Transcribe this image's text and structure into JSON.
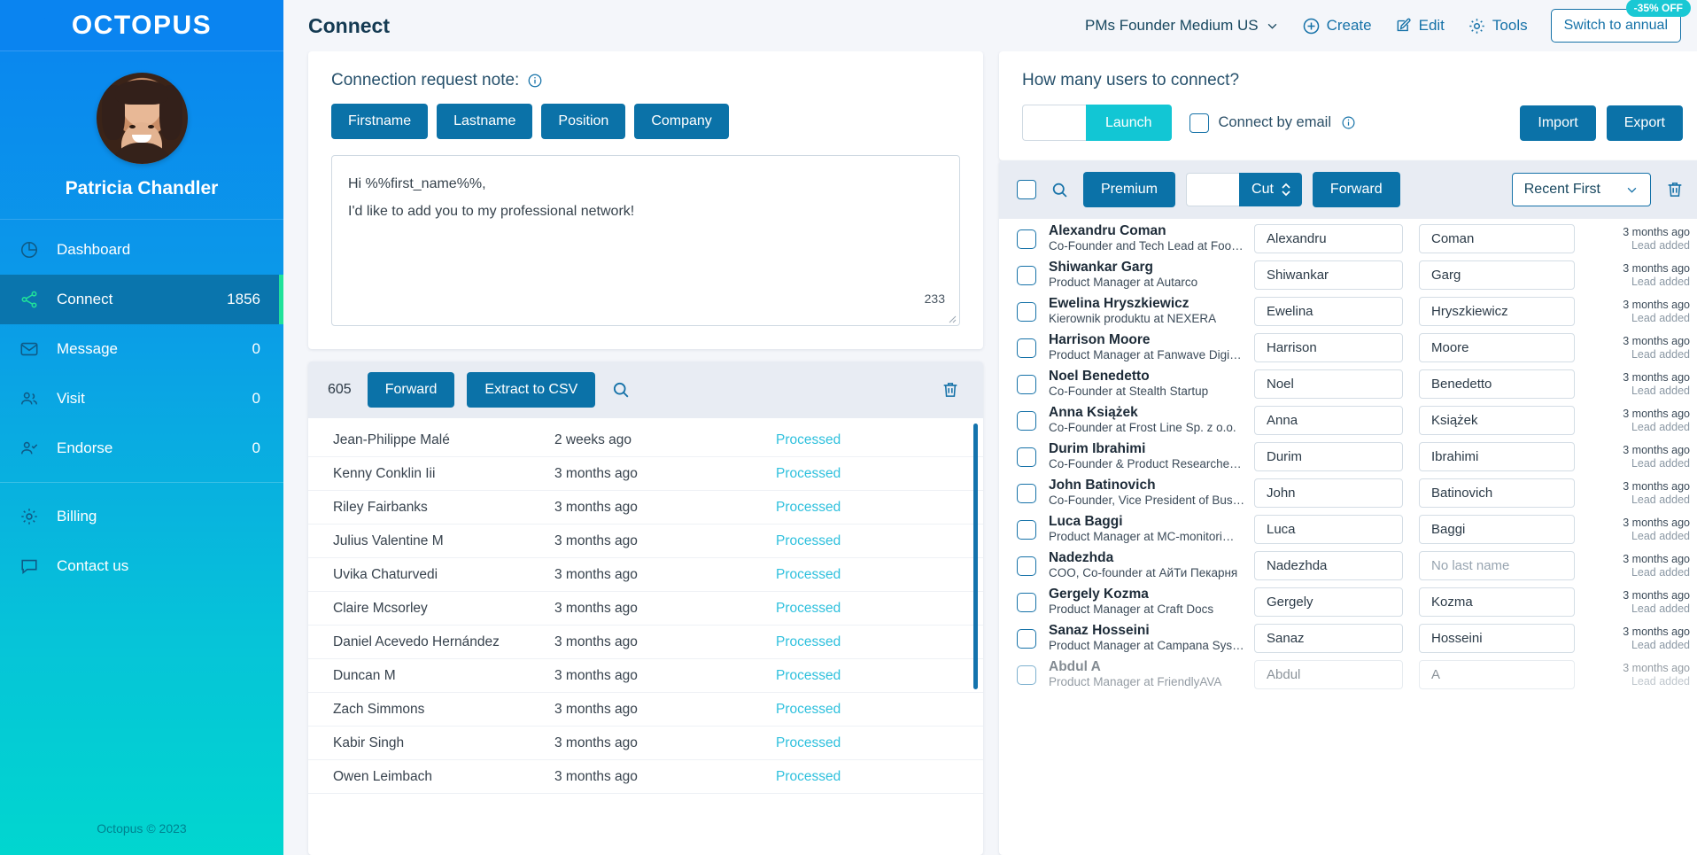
{
  "brand": {
    "logo": "OCTOPUS",
    "accent": "#0b72a8",
    "teal": "#12c6d4",
    "green": "#20e29a"
  },
  "sidebar": {
    "profile_name": "Patricia Chandler",
    "items": [
      {
        "label": "Dashboard",
        "count": "",
        "icon": "pie-chart-icon"
      },
      {
        "label": "Connect",
        "count": "1856",
        "icon": "share-nodes-icon"
      },
      {
        "label": "Message",
        "count": "0",
        "icon": "envelope-icon"
      },
      {
        "label": "Visit",
        "count": "0",
        "icon": "users-icon"
      },
      {
        "label": "Endorse",
        "count": "0",
        "icon": "user-check-icon"
      },
      {
        "label": "Billing",
        "count": "",
        "icon": "gear-icon"
      },
      {
        "label": "Contact us",
        "count": "",
        "icon": "chat-bubble-icon"
      }
    ],
    "footer": "Octopus © 2023"
  },
  "topbar": {
    "page_title": "Connect",
    "account": "PMs Founder Medium US",
    "create_label": "Create",
    "edit_label": "Edit",
    "tools_label": "Tools",
    "switch_label": "Switch to annual",
    "off_badge": "-35% OFF"
  },
  "note_card": {
    "title": "Connection request note:",
    "tags": [
      "Firstname",
      "Lastname",
      "Position",
      "Company"
    ],
    "body_line1": "Hi %%first_name%%,",
    "body_line2": "I'd like to add you to my professional network!",
    "char_count": "233"
  },
  "list_toolbar": {
    "count": "605",
    "forward_label": "Forward",
    "extract_label": "Extract to CSV"
  },
  "processed_list": {
    "status_label": "Processed",
    "rows": [
      {
        "name": "Jean-Philippe Malé",
        "time": "2 weeks ago",
        "status": "Processed"
      },
      {
        "name": "Kenny Conklin Iii",
        "time": "3 months ago",
        "status": "Processed"
      },
      {
        "name": "Riley Fairbanks",
        "time": "3 months ago",
        "status": "Processed"
      },
      {
        "name": "Julius Valentine M",
        "time": "3 months ago",
        "status": "Processed"
      },
      {
        "name": "Uvika Chaturvedi",
        "time": "3 months ago",
        "status": "Processed"
      },
      {
        "name": "Claire Mcsorley",
        "time": "3 months ago",
        "status": "Processed"
      },
      {
        "name": "Daniel Acevedo Hernández",
        "time": "3 months ago",
        "status": "Processed"
      },
      {
        "name": "Duncan M",
        "time": "3 months ago",
        "status": "Processed"
      },
      {
        "name": "Zach Simmons",
        "time": "3 months ago",
        "status": "Processed"
      },
      {
        "name": "Kabir Singh",
        "time": "3 months ago",
        "status": "Processed"
      },
      {
        "name": "Owen Leimbach",
        "time": "3 months ago",
        "status": "Processed"
      }
    ]
  },
  "connect_card": {
    "title": "How many users to connect?",
    "count_value": "",
    "launch_label": "Launch",
    "connect_by_email_label": "Connect by email",
    "import_label": "Import",
    "export_label": "Export"
  },
  "users_toolbar": {
    "premium_label": "Premium",
    "cut_value": "",
    "cut_label": "Cut",
    "forward_label": "Forward",
    "sort_label": "Recent First"
  },
  "users": {
    "no_last_name_placeholder": "No last name",
    "rows": [
      {
        "name": "Alexandru Coman",
        "sub": "Co-Founder and Tech Lead at Foo…",
        "first": "Alexandru",
        "last": "Coman",
        "last_empty": false,
        "time": "3 months ago",
        "event": "Lead added"
      },
      {
        "name": "Shiwankar Garg",
        "sub": "Product Manager at Autarco",
        "first": "Shiwankar",
        "last": "Garg",
        "last_empty": false,
        "time": "3 months ago",
        "event": "Lead added"
      },
      {
        "name": "Ewelina Hryszkiewicz",
        "sub": "Kierownik produktu at NEXERA",
        "first": "Ewelina",
        "last": "Hryszkiewicz",
        "last_empty": false,
        "time": "3 months ago",
        "event": "Lead added"
      },
      {
        "name": "Harrison Moore",
        "sub": "Product Manager at Fanwave Digi…",
        "first": "Harrison",
        "last": "Moore",
        "last_empty": false,
        "time": "3 months ago",
        "event": "Lead added"
      },
      {
        "name": "Noel Benedetto",
        "sub": "Co-Founder at Stealth Startup",
        "first": "Noel",
        "last": "Benedetto",
        "last_empty": false,
        "time": "3 months ago",
        "event": "Lead added"
      },
      {
        "name": "Anna Książek",
        "sub": "Co-Founder at Frost Line Sp. z o.o.",
        "first": "Anna",
        "last": "Książek",
        "last_empty": false,
        "time": "3 months ago",
        "event": "Lead added"
      },
      {
        "name": "Durim Ibrahimi",
        "sub": "Co-Founder & Product Researche…",
        "first": "Durim",
        "last": "Ibrahimi",
        "last_empty": false,
        "time": "3 months ago",
        "event": "Lead added"
      },
      {
        "name": "John Batinovich",
        "sub": "Co-Founder, Vice President of Bus…",
        "first": "John",
        "last": "Batinovich",
        "last_empty": false,
        "time": "3 months ago",
        "event": "Lead added"
      },
      {
        "name": "Luca Baggi",
        "sub": "Product Manager at MC-monitori…",
        "first": "Luca",
        "last": "Baggi",
        "last_empty": false,
        "time": "3 months ago",
        "event": "Lead added"
      },
      {
        "name": "Nadezhda",
        "sub": "COO, Co-founder at АйТи Пекарня",
        "first": "Nadezhda",
        "last": "No last name",
        "last_empty": true,
        "time": "3 months ago",
        "event": "Lead added"
      },
      {
        "name": "Gergely Kozma",
        "sub": "Product Manager at Craft Docs",
        "first": "Gergely",
        "last": "Kozma",
        "last_empty": false,
        "time": "3 months ago",
        "event": "Lead added"
      },
      {
        "name": "Sanaz Hosseini",
        "sub": "Product Manager at Campana Sys…",
        "first": "Sanaz",
        "last": "Hosseini",
        "last_empty": false,
        "time": "3 months ago",
        "event": "Lead added"
      },
      {
        "name": "Abdul A",
        "sub": "Product Manager at FriendlyAVA",
        "first": "Abdul",
        "last": "A",
        "last_empty": false,
        "time": "3 months ago",
        "event": "Lead added"
      }
    ]
  }
}
